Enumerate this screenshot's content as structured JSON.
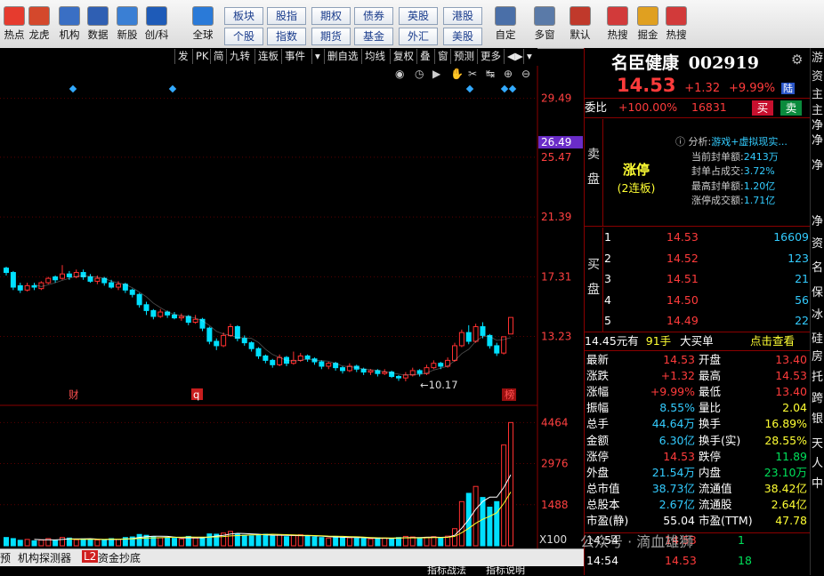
{
  "toolbar": {
    "items": [
      {
        "label": "热点",
        "icon": "hot-icon",
        "color": "#e63b2e"
      },
      {
        "label": "龙虎",
        "icon": "dragon-tiger-icon",
        "color": "#d4482c"
      },
      {
        "label": "机构",
        "icon": "institution-icon",
        "color": "#3a6fc4"
      },
      {
        "label": "数据",
        "icon": "pe-data-icon",
        "color": "#2f5fb3"
      },
      {
        "label": "新股",
        "icon": "new-stock-icon",
        "color": "#3a7fd4"
      },
      {
        "label": "创/科",
        "icon": "chuang-icon",
        "color": "#1e5bb8"
      },
      {
        "label": "全球",
        "icon": "globe-icon",
        "color": "#2a7ad8"
      }
    ],
    "markets_row1": [
      "板块",
      "股指",
      "期权",
      "债券",
      "英股",
      "港股"
    ],
    "markets_row2": [
      "个股",
      "指数",
      "期货",
      "基金",
      "外汇",
      "美股"
    ],
    "right_items": [
      {
        "label": "自定",
        "icon": "custom-icon",
        "color": "#4a6fa8"
      },
      {
        "label": "多窗",
        "icon": "multi-window-icon",
        "color": "#5a7aa8"
      },
      {
        "label": "默认",
        "icon": "home-icon",
        "color": "#c0392b"
      },
      {
        "label": "热搜",
        "icon": "hot-search-icon",
        "color": "#d23a3a"
      },
      {
        "label": "掘金",
        "icon": "gold-icon",
        "color": "#e0a020"
      },
      {
        "label": "热搜",
        "icon": "hot-search-2-icon",
        "color": "#d23a3a"
      }
    ]
  },
  "chart_toolbar": [
    "发",
    "PK",
    "简",
    "九转",
    "连板",
    "事件",
    "▾",
    "删自选",
    "均线",
    "复权",
    "叠",
    "窗",
    "预测",
    "更多",
    "◀▶",
    "▾"
  ],
  "chart_data": {
    "type": "candlestick",
    "price_axis": {
      "ticks": [
        "29.49",
        "25.47",
        "21.39",
        "17.31",
        "13.23"
      ],
      "highlight": "26.49"
    },
    "volume_axis": {
      "ticks": [
        "4464",
        "2976",
        "1488"
      ],
      "unit": "X100"
    },
    "ylim": [
      9.5,
      30.5
    ],
    "annotations": {
      "low_label": "←10.17",
      "markers": [
        "财",
        "q",
        "榜"
      ]
    },
    "candles": [
      {
        "o": 17.9,
        "c": 17.6,
        "h": 18.0,
        "l": 17.4
      },
      {
        "o": 17.6,
        "c": 16.6,
        "h": 17.7,
        "l": 16.4
      },
      {
        "o": 16.7,
        "c": 16.4,
        "h": 16.9,
        "l": 16.2
      },
      {
        "o": 16.4,
        "c": 16.7,
        "h": 16.9,
        "l": 16.3
      },
      {
        "o": 16.7,
        "c": 16.6,
        "h": 16.9,
        "l": 16.4
      },
      {
        "o": 16.5,
        "c": 16.9,
        "h": 17.0,
        "l": 16.4
      },
      {
        "o": 16.9,
        "c": 17.2,
        "h": 17.3,
        "l": 16.8
      },
      {
        "o": 17.3,
        "c": 17.1,
        "h": 17.4,
        "l": 16.9
      },
      {
        "o": 17.2,
        "c": 17.5,
        "h": 18.1,
        "l": 17.1
      },
      {
        "o": 17.5,
        "c": 17.3,
        "h": 17.7,
        "l": 17.1
      },
      {
        "o": 17.3,
        "c": 17.6,
        "h": 17.8,
        "l": 17.2
      },
      {
        "o": 17.6,
        "c": 17.3,
        "h": 17.8,
        "l": 17.1
      },
      {
        "o": 17.3,
        "c": 17.0,
        "h": 17.5,
        "l": 16.9
      },
      {
        "o": 17.0,
        "c": 17.2,
        "h": 17.4,
        "l": 16.8
      },
      {
        "o": 17.2,
        "c": 16.9,
        "h": 17.3,
        "l": 16.7
      },
      {
        "o": 16.9,
        "c": 16.6,
        "h": 17.1,
        "l": 16.5
      },
      {
        "o": 16.6,
        "c": 16.8,
        "h": 17.0,
        "l": 16.4
      },
      {
        "o": 16.8,
        "c": 16.4,
        "h": 16.9,
        "l": 16.2
      },
      {
        "o": 16.4,
        "c": 16.1,
        "h": 16.5,
        "l": 15.9
      },
      {
        "o": 16.1,
        "c": 15.4,
        "h": 16.2,
        "l": 15.2
      },
      {
        "o": 15.4,
        "c": 15.0,
        "h": 15.6,
        "l": 14.7
      },
      {
        "o": 15.0,
        "c": 14.6,
        "h": 15.1,
        "l": 14.4
      },
      {
        "o": 14.6,
        "c": 14.9,
        "h": 15.1,
        "l": 14.5
      },
      {
        "o": 14.9,
        "c": 14.7,
        "h": 15.0,
        "l": 14.5
      },
      {
        "o": 14.7,
        "c": 14.5,
        "h": 14.9,
        "l": 14.4
      },
      {
        "o": 14.5,
        "c": 14.6,
        "h": 14.8,
        "l": 14.3
      },
      {
        "o": 14.6,
        "c": 14.2,
        "h": 14.7,
        "l": 14.0
      },
      {
        "o": 14.2,
        "c": 14.4,
        "h": 14.7,
        "l": 14.1
      },
      {
        "o": 14.4,
        "c": 13.8,
        "h": 14.5,
        "l": 13.6
      },
      {
        "o": 13.8,
        "c": 12.9,
        "h": 13.9,
        "l": 12.7
      },
      {
        "o": 12.9,
        "c": 12.6,
        "h": 13.1,
        "l": 12.3
      },
      {
        "o": 12.6,
        "c": 13.3,
        "h": 13.5,
        "l": 12.5
      },
      {
        "o": 13.3,
        "c": 13.9,
        "h": 14.1,
        "l": 13.2
      },
      {
        "o": 13.9,
        "c": 13.1,
        "h": 14.0,
        "l": 12.9
      },
      {
        "o": 13.1,
        "c": 12.8,
        "h": 13.3,
        "l": 12.6
      },
      {
        "o": 12.8,
        "c": 12.4,
        "h": 12.9,
        "l": 12.2
      },
      {
        "o": 12.4,
        "c": 11.9,
        "h": 12.5,
        "l": 11.7
      },
      {
        "o": 11.9,
        "c": 11.6,
        "h": 12.0,
        "l": 11.4
      },
      {
        "o": 11.6,
        "c": 11.3,
        "h": 11.7,
        "l": 11.1
      },
      {
        "o": 11.3,
        "c": 11.8,
        "h": 12.0,
        "l": 11.2
      },
      {
        "o": 11.8,
        "c": 11.4,
        "h": 11.9,
        "l": 11.2
      },
      {
        "o": 11.4,
        "c": 11.6,
        "h": 12.2,
        "l": 11.3
      },
      {
        "o": 11.6,
        "c": 11.9,
        "h": 12.1,
        "l": 11.5
      },
      {
        "o": 11.9,
        "c": 11.7,
        "h": 12.0,
        "l": 11.5
      },
      {
        "o": 11.7,
        "c": 11.5,
        "h": 11.8,
        "l": 11.3
      },
      {
        "o": 11.5,
        "c": 11.2,
        "h": 11.6,
        "l": 11.0
      },
      {
        "o": 11.2,
        "c": 11.4,
        "h": 11.5,
        "l": 11.0
      },
      {
        "o": 11.4,
        "c": 11.1,
        "h": 11.5,
        "l": 10.9
      },
      {
        "o": 11.1,
        "c": 10.9,
        "h": 11.2,
        "l": 10.7
      },
      {
        "o": 10.9,
        "c": 11.2,
        "h": 11.4,
        "l": 10.8
      },
      {
        "o": 11.2,
        "c": 11.0,
        "h": 11.3,
        "l": 10.8
      },
      {
        "o": 11.0,
        "c": 10.8,
        "h": 11.1,
        "l": 10.6
      },
      {
        "o": 10.8,
        "c": 10.9,
        "h": 11.0,
        "l": 10.6
      },
      {
        "o": 10.9,
        "c": 10.7,
        "h": 11.0,
        "l": 10.5
      },
      {
        "o": 10.7,
        "c": 10.8,
        "h": 11.0,
        "l": 10.6
      },
      {
        "o": 10.8,
        "c": 10.5,
        "h": 10.9,
        "l": 10.4
      },
      {
        "o": 10.5,
        "c": 10.4,
        "h": 10.6,
        "l": 10.2
      },
      {
        "o": 10.4,
        "c": 10.6,
        "h": 10.8,
        "l": 10.17
      },
      {
        "o": 10.6,
        "c": 10.9,
        "h": 11.1,
        "l": 10.5
      },
      {
        "o": 10.9,
        "c": 10.7,
        "h": 11.0,
        "l": 10.5
      },
      {
        "o": 10.7,
        "c": 11.1,
        "h": 11.3,
        "l": 10.6
      },
      {
        "o": 11.1,
        "c": 11.4,
        "h": 11.6,
        "l": 11.0
      },
      {
        "o": 11.4,
        "c": 11.2,
        "h": 11.5,
        "l": 11.0
      },
      {
        "o": 11.2,
        "c": 11.6,
        "h": 11.8,
        "l": 11.1
      },
      {
        "o": 11.6,
        "c": 12.6,
        "h": 12.8,
        "l": 11.5
      },
      {
        "o": 12.6,
        "c": 13.5,
        "h": 13.7,
        "l": 12.5
      },
      {
        "o": 13.5,
        "c": 12.9,
        "h": 14.0,
        "l": 12.7
      },
      {
        "o": 12.9,
        "c": 13.9,
        "h": 14.1,
        "l": 12.8
      },
      {
        "o": 13.9,
        "c": 13.3,
        "h": 14.2,
        "l": 13.1
      },
      {
        "o": 13.3,
        "c": 12.6,
        "h": 13.4,
        "l": 12.4
      },
      {
        "o": 12.6,
        "c": 12.1,
        "h": 12.8,
        "l": 11.9
      },
      {
        "o": 12.1,
        "c": 13.21,
        "h": 13.21,
        "l": 12.0
      },
      {
        "o": 13.4,
        "c": 14.53,
        "h": 14.53,
        "l": 13.4
      }
    ],
    "volumes": [
      300,
      260,
      200,
      230,
      180,
      210,
      260,
      190,
      300,
      280,
      220,
      250,
      240,
      210,
      200,
      260,
      230,
      300,
      320,
      410,
      380,
      330,
      290,
      300,
      270,
      250,
      340,
      280,
      300,
      430,
      420,
      460,
      520,
      430,
      380,
      360,
      400,
      420,
      350,
      390,
      330,
      370,
      400,
      360,
      320,
      300,
      280,
      340,
      310,
      290,
      270,
      260,
      250,
      290,
      280,
      260,
      300,
      340,
      320,
      280,
      310,
      330,
      290,
      350,
      620,
      1600,
      1900,
      2150,
      1750,
      1400,
      1600,
      3650,
      4464
    ]
  },
  "stock": {
    "name": "名臣健康",
    "code": "002919",
    "price": "14.53",
    "change": "+1.32",
    "pct": "+9.99%",
    "tag": "陆",
    "weibi_label": "委比",
    "weibi": "+100.00%",
    "weicha": "16831",
    "buy_btn": "买",
    "sell_btn": "卖",
    "limit_up": "涨停",
    "limit_sub": "(2连板)",
    "analysis_label": "分析:",
    "analysis": "游戏+虚拟现实...",
    "seal_amt_label": "当前封单额:",
    "seal_amt": "2413万",
    "seal_ratio_label": "封单占成交:",
    "seal_ratio": "3.72%",
    "max_seal_label": "最高封单额:",
    "max_seal": "1.20亿",
    "limit_turn_label": "涨停成交额:",
    "limit_turn": "1.71亿",
    "sell_side": "卖盘",
    "buy_side": "买盘",
    "bids": [
      [
        "1",
        "14.53",
        "16609"
      ],
      [
        "2",
        "14.52",
        "123"
      ],
      [
        "3",
        "14.51",
        "21"
      ],
      [
        "4",
        "14.50",
        "56"
      ],
      [
        "5",
        "14.49",
        "22"
      ]
    ],
    "big_order": {
      "price": "14.45元有",
      "qty": "91手",
      "label": "大买单",
      "link": "点击查看"
    },
    "quote": [
      [
        "最新",
        "14.53",
        "开盘",
        "13.40"
      ],
      [
        "涨跌",
        "+1.32",
        "最高",
        "14.53"
      ],
      [
        "涨幅",
        "+9.99%",
        "最低",
        "13.40"
      ],
      [
        "振幅",
        "8.55%",
        "量比",
        "2.04"
      ],
      [
        "总手",
        "44.64万",
        "换手",
        "16.89%"
      ],
      [
        "金额",
        "6.30亿",
        "换手(实)",
        "28.55%"
      ],
      [
        "涨停",
        "14.53",
        "跌停",
        "11.89"
      ],
      [
        "外盘",
        "21.54万",
        "内盘",
        "23.10万"
      ],
      [
        "总市值",
        "38.73亿",
        "流通值",
        "38.42亿"
      ],
      [
        "总股本",
        "2.67亿",
        "流通股",
        "2.64亿"
      ],
      [
        "市盈(静)",
        "55.04",
        "市盈(TTM)",
        "47.78"
      ]
    ],
    "ticks": [
      [
        "14:54",
        "14.53",
        "1"
      ],
      [
        "14:54",
        "14.53",
        "18"
      ]
    ]
  },
  "right_edge": [
    "游",
    "资",
    "主",
    "主",
    "净",
    "净",
    "净",
    "净",
    "资",
    "名",
    "保",
    "冰",
    "硅",
    "房",
    "托",
    "跨",
    "银",
    "天",
    "人",
    "中"
  ],
  "bottom_tabs": [
    "预",
    "机构探测器",
    "L2",
    "资金抄底"
  ],
  "bottom_right": [
    "指标战法",
    "指标说明"
  ],
  "watermark": "公众号 · 滴血雄狮"
}
